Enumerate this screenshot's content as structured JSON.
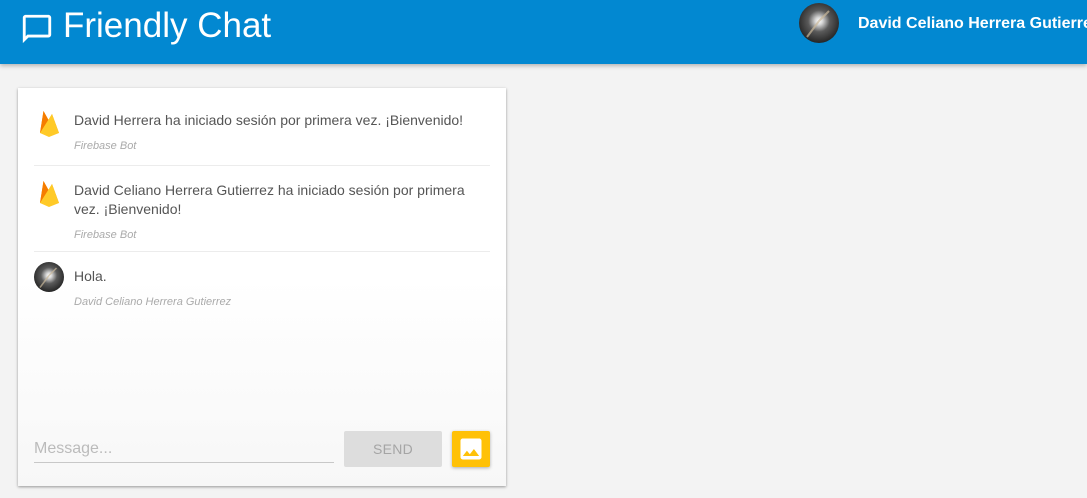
{
  "header": {
    "title": "Friendly Chat",
    "logo_icon": "chat-bubble-icon",
    "user_name": "David Celiano Herrera Gutierrez",
    "background_color": "#0288d1"
  },
  "messages": [
    {
      "text": "David Herrera ha iniciado sesión por primera vez. ¡Bienvenido!",
      "author": "Firebase Bot",
      "avatar": "firebase-flame-icon"
    },
    {
      "text": "David Celiano Herrera Gutierrez ha iniciado sesión por primera vez. ¡Bienvenido!",
      "author": "Firebase Bot",
      "avatar": "firebase-flame-icon"
    },
    {
      "text": "Hola.",
      "author": "David Celiano Herrera Gutierrez",
      "avatar": "user-photo"
    }
  ],
  "composer": {
    "placeholder": "Message...",
    "send_label": "SEND",
    "image_button_icon": "image-icon",
    "image_button_color": "#ffc107"
  }
}
